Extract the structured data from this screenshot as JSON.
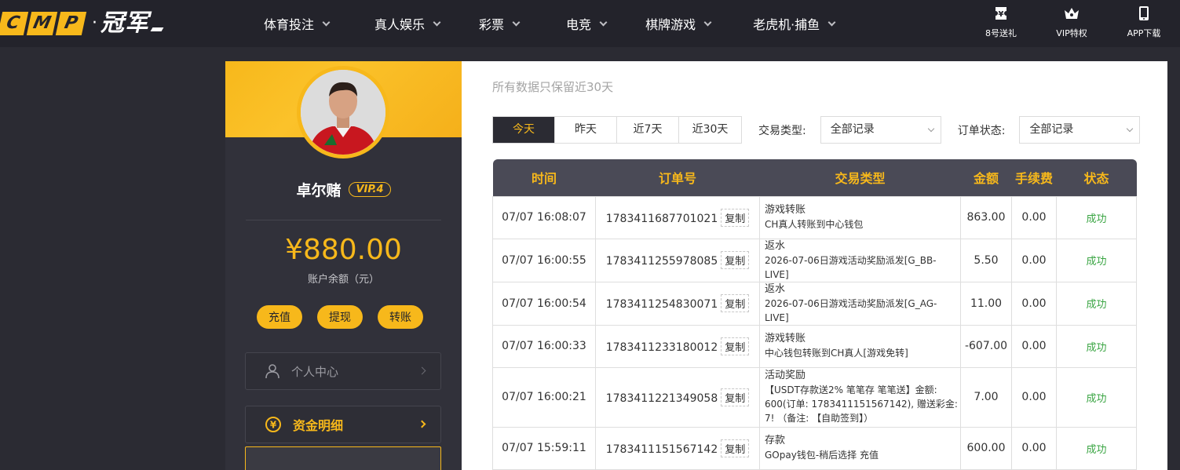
{
  "logo": {
    "letters": [
      "C",
      "M",
      "P"
    ],
    "dot": "·",
    "name": "冠军"
  },
  "nav": [
    {
      "label": "体育投注"
    },
    {
      "label": "真人娱乐"
    },
    {
      "label": "彩票"
    },
    {
      "label": "电竞"
    },
    {
      "label": "棋牌游戏"
    },
    {
      "label": "老虎机·捕鱼"
    }
  ],
  "tools": [
    {
      "label": "8号送礼",
      "icon": "ticket-icon"
    },
    {
      "label": "VIP特权",
      "icon": "crown-icon"
    },
    {
      "label": "APP下载",
      "icon": "phone-icon"
    }
  ],
  "profile": {
    "username": "卓尔赌",
    "vip": "VIP.4",
    "balance": "¥880.00",
    "balance_label": "账户余额（元）",
    "actions": [
      "充值",
      "提现",
      "转账"
    ]
  },
  "menu": [
    {
      "label": "个人中心",
      "icon": "user-icon"
    },
    {
      "label": "资金明细",
      "icon": "yuan-coin-icon"
    }
  ],
  "main": {
    "subtitle": "所有数据只保留近30天"
  },
  "filters": {
    "ranges": [
      "今天",
      "昨天",
      "近7天",
      "近30天"
    ],
    "active_range": "今天",
    "type_label": "交易类型:",
    "type_value": "全部记录",
    "status_label": "订单状态:",
    "status_value": "全部记录"
  },
  "table": {
    "headers": [
      "时间",
      "订单号",
      "交易类型",
      "金额",
      "手续费",
      "状态"
    ],
    "copy_label": "复制",
    "rows": [
      {
        "time": "07/07 16:08:07",
        "order": "1783411687701021",
        "type": "游戏转账",
        "desc": "CH真人转账到中心钱包",
        "amount": "863.00",
        "fee": "0.00",
        "status": "成功"
      },
      {
        "time": "07/07 16:00:55",
        "order": "1783411255978085",
        "type": "返水",
        "desc": "2026-07-06日游戏活动奖励派发[G_BB-LIVE]",
        "amount": "5.50",
        "fee": "0.00",
        "status": "成功"
      },
      {
        "time": "07/07 16:00:54",
        "order": "1783411254830071",
        "type": "返水",
        "desc": "2026-07-06日游戏活动奖励派发[G_AG-LIVE]",
        "amount": "11.00",
        "fee": "0.00",
        "status": "成功"
      },
      {
        "time": "07/07 16:00:33",
        "order": "1783411233180012",
        "type": "游戏转账",
        "desc": "中心钱包转账到CH真人[游戏免转]",
        "amount": "-607.00",
        "fee": "0.00",
        "status": "成功"
      },
      {
        "time": "07/07 16:00:21",
        "order": "1783411221349058",
        "type": "活动奖励",
        "desc": "【USDT存款送2% 笔笔存 笔笔送】金额: 600(订单: 1783411151567142), 赠送彩金: 7! （备注: 【自助签到】）",
        "amount": "7.00",
        "fee": "0.00",
        "status": "成功"
      },
      {
        "time": "07/07 15:59:11",
        "order": "1783411151567142",
        "type": "存款",
        "desc": "GOpay钱包-稍后选择 充值",
        "amount": "600.00",
        "fee": "0.00",
        "status": "成功"
      }
    ]
  },
  "colors": {
    "accent": "#f7b81b",
    "dark": "#23232b",
    "success": "#3aa543"
  }
}
